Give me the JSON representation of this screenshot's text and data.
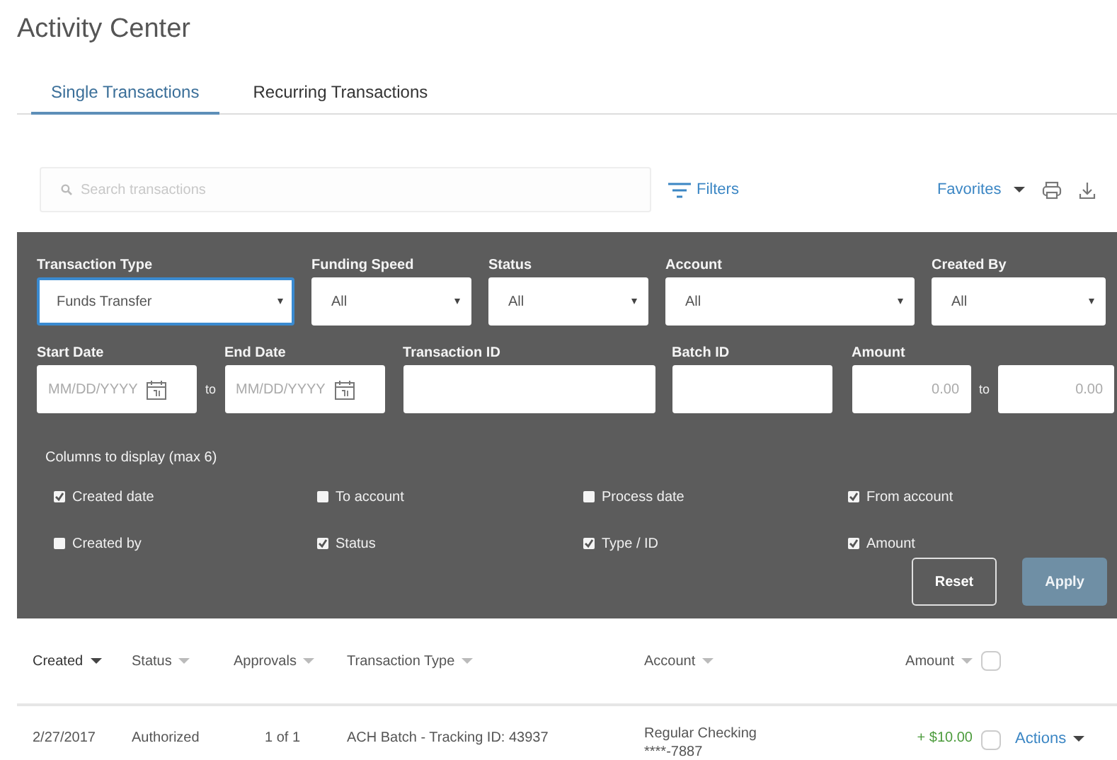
{
  "page": {
    "title": "Activity Center"
  },
  "tabs": [
    {
      "label": "Single Transactions",
      "selected": true
    },
    {
      "label": "Recurring Transactions",
      "selected": false
    }
  ],
  "toolbar": {
    "search": {
      "placeholder": "Search transactions"
    },
    "filters_label": "Filters",
    "favorites_label": "Favorites"
  },
  "filters": {
    "selects": [
      {
        "label": "Transaction Type",
        "value": "Funds Transfer",
        "focused": true
      },
      {
        "label": "Funding Speed",
        "value": "All",
        "focused": false
      },
      {
        "label": "Status",
        "value": "All",
        "focused": false
      },
      {
        "label": "Account",
        "value": "All",
        "focused": false
      },
      {
        "label": "Created By",
        "value": "All",
        "focused": false
      }
    ],
    "inputs": [
      {
        "kind": "date",
        "label": "Start Date",
        "placeholder": "MM/DD/YYYY"
      },
      {
        "kind": "separator",
        "text": "to"
      },
      {
        "kind": "date",
        "label": "End Date",
        "placeholder": "MM/DD/YYYY"
      },
      {
        "kind": "text",
        "label": "Transaction ID"
      },
      {
        "kind": "text",
        "label": "Batch ID"
      },
      {
        "kind": "number",
        "label": "Amount",
        "placeholder": "0.00"
      },
      {
        "kind": "separator",
        "text": "to"
      },
      {
        "kind": "number",
        "placeholder": "0.00"
      }
    ],
    "columns_label": "Columns to display (max 6)",
    "column_options": [
      {
        "label": "Created date",
        "checked": true
      },
      {
        "label": "To account",
        "checked": false
      },
      {
        "label": "Process date",
        "checked": false
      },
      {
        "label": "From account",
        "checked": true
      },
      {
        "label": "Created by",
        "checked": false
      },
      {
        "label": "Status",
        "checked": true
      },
      {
        "label": "Type / ID",
        "checked": true
      },
      {
        "label": "Amount",
        "checked": true
      }
    ],
    "buttons": [
      {
        "label": "Reset",
        "kind": "secondary"
      },
      {
        "label": "Apply",
        "kind": "primary"
      }
    ]
  },
  "table": {
    "columns": [
      {
        "label": "Created",
        "sorted": true
      },
      {
        "label": "Status",
        "sorted": false
      },
      {
        "label": "Approvals",
        "sorted": false
      },
      {
        "label": "Transaction Type",
        "sorted": false
      },
      {
        "label": "Account",
        "sorted": false
      },
      {
        "label": "Amount",
        "sorted": false
      }
    ],
    "select_all": {
      "checked": false
    },
    "rows": [
      {
        "created": "2/27/2017",
        "status": "Authorized",
        "approvals": "1 of 1",
        "transaction_type": "ACH Batch - Tracking ID: 43937",
        "account": [
          "Regular Checking",
          "****-7887"
        ],
        "amount": "+ $10.00",
        "kind": "credit",
        "selected": false,
        "actions_label": "Actions"
      }
    ]
  }
}
